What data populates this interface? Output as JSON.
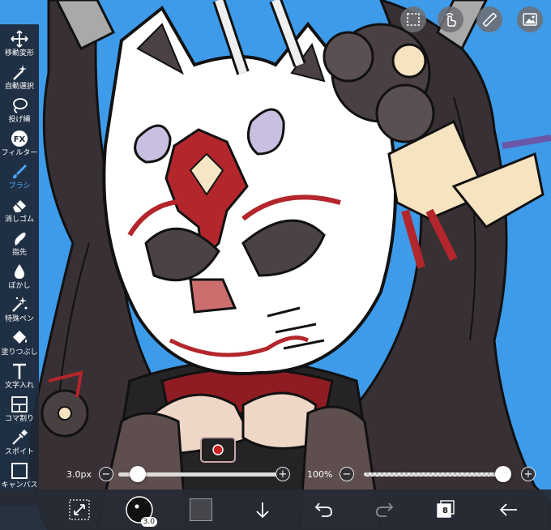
{
  "tools": [
    {
      "name": "tool-move",
      "icon": "move-arrows-icon",
      "label": "移動変形"
    },
    {
      "name": "tool-magic-wand",
      "icon": "magic-wand-icon",
      "label": "自動選択"
    },
    {
      "name": "tool-lasso",
      "icon": "lasso-icon",
      "label": "投げ縄"
    },
    {
      "name": "tool-filter",
      "icon": "fx-icon",
      "label": "フィルター"
    },
    {
      "name": "tool-brush",
      "icon": "brush-icon",
      "label": "ブラシ",
      "active": true
    },
    {
      "name": "tool-eraser",
      "icon": "eraser-icon",
      "label": "消しゴム"
    },
    {
      "name": "tool-smudge",
      "icon": "finger-icon",
      "label": "指先"
    },
    {
      "name": "tool-blur",
      "icon": "drop-icon",
      "label": "ぼかし"
    },
    {
      "name": "tool-special-pen",
      "icon": "sparkle-pen-icon",
      "label": "特殊ペン"
    },
    {
      "name": "tool-fill",
      "icon": "bucket-icon",
      "label": "塗りつぶし"
    },
    {
      "name": "tool-text",
      "icon": "text-t-icon",
      "label": "文字入れ"
    },
    {
      "name": "tool-frame-divider",
      "icon": "frame-icon",
      "label": "コマ割り"
    },
    {
      "name": "tool-eyedropper",
      "icon": "eyedropper-icon",
      "label": "スポイト"
    },
    {
      "name": "tool-canvas",
      "icon": "canvas-square-icon",
      "label": "キャンバス"
    }
  ],
  "brush_size": {
    "label": "3.0px",
    "value_fraction": 0.12
  },
  "opacity": {
    "label": "100%",
    "value_fraction": 1.0
  },
  "bottom": {
    "brush_size_badge": "3.0",
    "layer_count": "8"
  },
  "colors": {
    "accent": "#4aa8ff",
    "primary_color": "#45474c",
    "canvas_background": "#3d9be9"
  }
}
